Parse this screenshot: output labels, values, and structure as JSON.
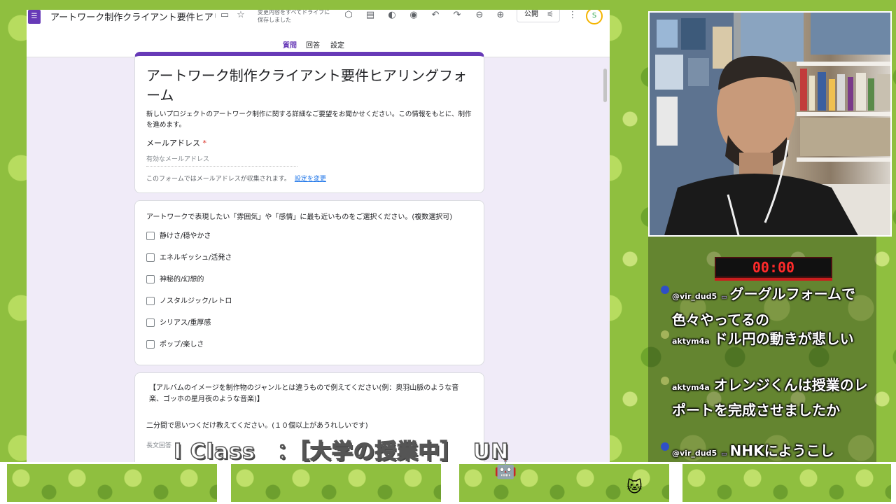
{
  "forms": {
    "doc_title": "アートワーク制作クライアント要件ヒアリン",
    "save_status": "変更内容をすべてドライブに保存しました",
    "publish_label": "公開",
    "avatar_text": "S",
    "tabs": {
      "questions": "質問",
      "responses": "回答",
      "settings": "設定"
    },
    "form_title": "アートワーク制作クライアント要件ヒアリングフォーム",
    "form_description": "新しいプロジェクトのアートワーク制作に関する詳細なご要望をお聞かせください。この情報をもとに、制作を進めます。",
    "email_label": "メールアドレス",
    "required_mark": "*",
    "email_placeholder": "有効なメールアドレス",
    "email_note": "このフォームではメールアドレスが収集されます。",
    "change_setting": "設定を変更",
    "q1": {
      "title": "アートワークで表現したい「雰囲気」や「感情」に最も近いものをご選択ください。(複数選択可)",
      "options": [
        "静けさ/穏やかさ",
        "エネルギッシュ/活発さ",
        "神秘的/幻想的",
        "ノスタルジック/レトロ",
        "シリアス/重厚感",
        "ポップ/楽しさ"
      ]
    },
    "q2": {
      "text": "【アルバムのイメージを制作物のジャンルとは違うもので例えてください(例：奥羽山脈のような音楽、ゴッホの星月夜のような音楽)】",
      "subtext": "二分間で思いつくだけ教えてください。(１０個以上があうれしいです)",
      "answer_placeholder": "長文回答"
    }
  },
  "timer": "00:00",
  "chat": [
    {
      "user": "@vir_dud5",
      "badge": "▭",
      "message": "グーグルフォームで色々やってるの"
    },
    {
      "user": "aktym4a",
      "badge": "",
      "message": "ドル円の動きが悲しい"
    },
    {
      "user": "aktym4a",
      "badge": "",
      "message": "オレンジくんは授業のレポートを完成させましたか"
    },
    {
      "user": "@vir_dud5",
      "badge": "▭",
      "message": "NHKにようこし"
    }
  ],
  "caption": "I Class　：［大学の授業中］　UN",
  "colors": {
    "accent": "#673ab7",
    "timer": "#ff2a2a",
    "background": "#8fbf3f"
  }
}
